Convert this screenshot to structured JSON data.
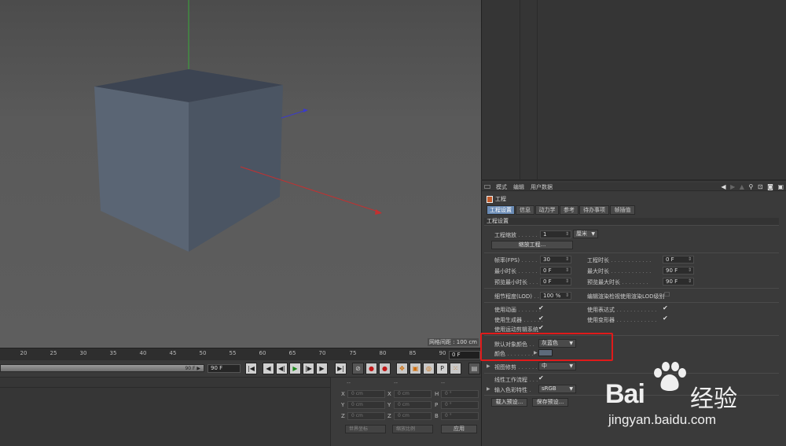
{
  "viewport": {
    "grid_label": "网格间距 : 100 cm"
  },
  "timeline": {
    "ticks": [
      "20",
      "25",
      "30",
      "35",
      "40",
      "45",
      "50",
      "55",
      "60",
      "65",
      "70",
      "75",
      "80",
      "85",
      "90"
    ],
    "current_frame": "0 F"
  },
  "transport": {
    "slider_value": "90 F ▶",
    "end_frame": "90 F",
    "buttons": [
      "|◀",
      "◀",
      "◀|",
      "▶",
      "|▶",
      "▶",
      "▶|"
    ]
  },
  "coordinates": {
    "headers": [
      "--",
      "--",
      "--"
    ],
    "rows": [
      {
        "a": "X",
        "av": "0 cm",
        "b": "X",
        "bv": "0 cm",
        "c": "H",
        "cv": "0 °"
      },
      {
        "a": "Y",
        "av": "0 cm",
        "b": "Y",
        "bv": "0 cm",
        "c": "P",
        "cv": "0 °"
      },
      {
        "a": "Z",
        "av": "0 cm",
        "b": "Z",
        "bv": "0 cm",
        "c": "B",
        "cv": "0 °"
      }
    ],
    "world_label": "世界坐标",
    "scale_label": "缩放比例",
    "apply": "应用"
  },
  "attributes": {
    "menu": [
      "模式",
      "编辑",
      "用户数据"
    ],
    "title": "工程",
    "tabs": [
      "工程设置",
      "信息",
      "动力学",
      "参考",
      "待办事项",
      "帧插值"
    ],
    "active_tab": 0,
    "section": "工程设置",
    "scale_label": "工程缩放",
    "scale_value": "1",
    "scale_unit": "厘米",
    "scale_button": "缩放工程...",
    "fps_label": "帧率(FPS)",
    "fps_value": "30",
    "project_time_label": "工程时长",
    "project_time_value": "0 F",
    "min_time_label": "最小时长",
    "min_time_value": "0 F",
    "max_time_label": "最大时长",
    "max_time_value": "90 F",
    "preview_min_label": "预览最小时长",
    "preview_min_value": "0 F",
    "preview_max_label": "预览最大时长",
    "preview_max_value": "90 F",
    "lod_label": "细节程度(LOD)",
    "lod_value": "100 %",
    "lod_render_label": "编辑渲染检视使用渲染LOD级别",
    "use_anim_label": "使用动画",
    "use_expr_label": "使用表达式",
    "use_gen_label": "使用生成器",
    "use_deform_label": "使用变形器",
    "use_motion_label": "使用运动剪辑系统",
    "default_color_label": "默认对象颜色",
    "default_color_value": "灰蓝色",
    "color_label": "颜色",
    "view_clip_label": "视图修剪",
    "view_clip_value": "中",
    "linear_workflow_label": "线性工作流程",
    "input_color_label": "输入色彩特性",
    "input_color_value": "sRGB",
    "load_preset": "载入预设...",
    "save_preset": "保存预设..."
  },
  "watermark": {
    "brand": "Bai",
    "brand_cn": "经验",
    "url": "jingyan.baidu.com"
  }
}
